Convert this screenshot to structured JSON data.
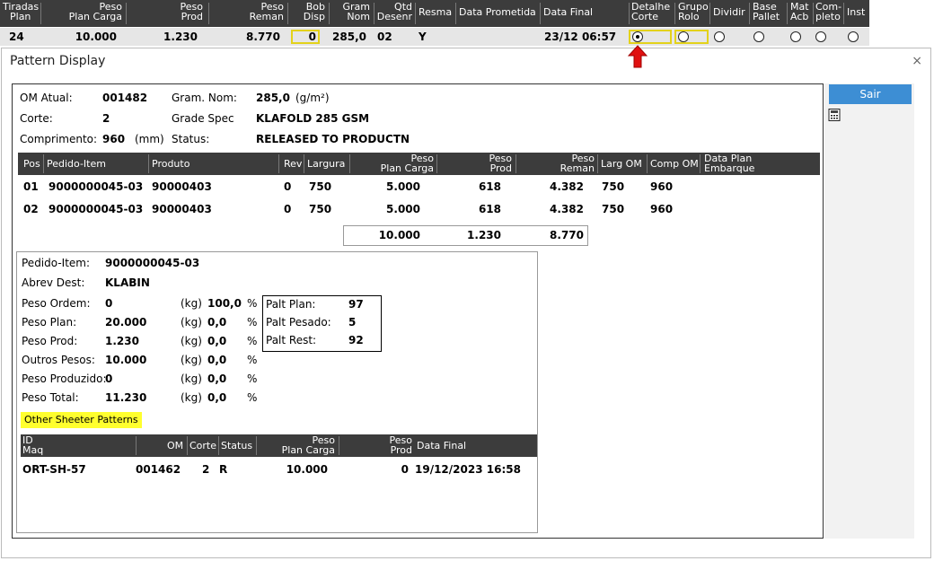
{
  "top_grid": {
    "headers": {
      "tiradas": [
        "Tiradas",
        "Plan"
      ],
      "peso_plan_carga": [
        "Peso",
        "Plan Carga"
      ],
      "peso_prod": [
        "Peso",
        "Prod"
      ],
      "peso_reman": [
        "Peso",
        "Reman"
      ],
      "bob_disp": [
        "Bob",
        "Disp"
      ],
      "gram_nom": [
        "Gram",
        "Nom"
      ],
      "qtd_desenr": [
        "Qtd",
        "Desenr"
      ],
      "resma": "Resma",
      "data_prometida": "Data Prometida",
      "data_final": "Data Final",
      "detalhe_corte": [
        "Detalhe",
        "Corte"
      ],
      "grupo_rolo": [
        "Grupo",
        "Rolo"
      ],
      "dividir": "Dividir",
      "base_pallet": [
        "Base",
        "Pallet"
      ],
      "mat_acb": [
        "Mat",
        "Acb"
      ],
      "completo": [
        "Com-",
        "pleto"
      ],
      "inst": "Inst"
    },
    "row": {
      "tiradas": "24",
      "peso_plan_carga": "10.000",
      "peso_prod": "1.230",
      "peso_reman": "8.770",
      "bob_disp": "0",
      "gram_nom": "285,0",
      "qtd_desenr": "02",
      "resma": "Y",
      "data_prometida": "",
      "data_final": "23/12 06:57"
    }
  },
  "dialog": {
    "title": "Pattern Display",
    "close": "×",
    "sair_label": "Sair"
  },
  "summary": {
    "om_atual_label": "OM Atual:",
    "om_atual": "001482",
    "gram_nom_label": "Gram. Nom:",
    "gram_nom": "285,0",
    "gram_unit": "(g/m²)",
    "corte_label": "Corte:",
    "corte": "2",
    "grade_spec_label": "Grade Spec",
    "grade_spec": "KLAFOLD 285 GSM",
    "comprimento_label": "Comprimento:",
    "comprimento": "960",
    "comprimento_unit": "(mm)",
    "status_label": "Status:",
    "status": "RELEASED TO PRODUCTN"
  },
  "patterns": {
    "headers": {
      "pos": "Pos",
      "pedido_item": "Pedido-Item",
      "produto": "Produto",
      "rev": "Rev",
      "largura": "Largura",
      "peso_plan_carga": [
        "Peso",
        "Plan Carga"
      ],
      "peso_prod": [
        "Peso",
        "Prod"
      ],
      "peso_reman": [
        "Peso",
        "Reman"
      ],
      "larg_om": "Larg OM",
      "comp_om": "Comp OM",
      "data_plan_embarque": [
        "Data Plan",
        "Embarque"
      ]
    },
    "rows": [
      {
        "pos": "01",
        "pedido_item": "9000000045-03",
        "produto": "90000403",
        "rev": "0",
        "largura": "750",
        "peso_plan_carga": "5.000",
        "peso_prod": "618",
        "peso_reman": "4.382",
        "larg_om": "750",
        "comp_om": "960"
      },
      {
        "pos": "02",
        "pedido_item": "9000000045-03",
        "produto": "90000403",
        "rev": "0",
        "largura": "750",
        "peso_plan_carga": "5.000",
        "peso_prod": "618",
        "peso_reman": "4.382",
        "larg_om": "750",
        "comp_om": "960"
      }
    ],
    "totals": {
      "peso_plan_carga": "10.000",
      "peso_prod": "1.230",
      "peso_reman": "8.770"
    }
  },
  "detail": {
    "pedido_item_label": "Pedido-Item:",
    "pedido_item": "9000000045-03",
    "abrev_dest_label": "Abrev Dest:",
    "abrev_dest": "KLABIN",
    "lines": [
      {
        "label": "Peso Ordem:",
        "value": "0",
        "unit": "(kg)",
        "pct": "100,0",
        "pct_sign": "%"
      },
      {
        "label": "Peso Plan:",
        "value": "20.000",
        "unit": "(kg)",
        "pct": "0,0",
        "pct_sign": "%"
      },
      {
        "label": "Peso Prod:",
        "value": "1.230",
        "unit": "(kg)",
        "pct": "0,0",
        "pct_sign": "%"
      },
      {
        "label": "Outros Pesos:",
        "value": "10.000",
        "unit": "(kg)",
        "pct": "0,0",
        "pct_sign": "%"
      },
      {
        "label": "Peso Produzido:",
        "value": "0",
        "unit": "(kg)",
        "pct": "0,0",
        "pct_sign": "%"
      },
      {
        "label": "Peso Total:",
        "value": "11.230",
        "unit": "(kg)",
        "pct": "0,0",
        "pct_sign": "%"
      }
    ],
    "palt": [
      {
        "label": "Palt Plan:",
        "value": "97"
      },
      {
        "label": "Palt Pesado:",
        "value": "5"
      },
      {
        "label": "Palt Rest:",
        "value": "92"
      }
    ],
    "other_label": "Other Sheeter Patterns",
    "other_headers": {
      "id_maq": [
        "ID",
        "Maq"
      ],
      "om": "OM",
      "corte": "Corte",
      "status": "Status",
      "peso_plan_carga": [
        "Peso",
        "Plan Carga"
      ],
      "peso_prod": [
        "Peso",
        "Prod"
      ],
      "data_final": "Data Final"
    },
    "other_rows": [
      {
        "id_maq": "ORT-SH-57",
        "om": "001462",
        "corte": "2",
        "status": "R",
        "peso_plan_carga": "10.000",
        "peso_prod": "0",
        "data_final": "19/12/2023 16:58"
      }
    ]
  },
  "icons": {
    "selected_radio": "radio-selected-icon",
    "arrow": "red-up-arrow-icon",
    "calculator": "calculator-icon"
  },
  "colors": {
    "header_bg": "#3c3c3c",
    "row_bg": "#e6e6e6",
    "highlight_box": "#e3d21b",
    "arrow_red": "#e01010",
    "button_blue": "#3d8ed4",
    "other_highlight": "#ffff2e"
  }
}
